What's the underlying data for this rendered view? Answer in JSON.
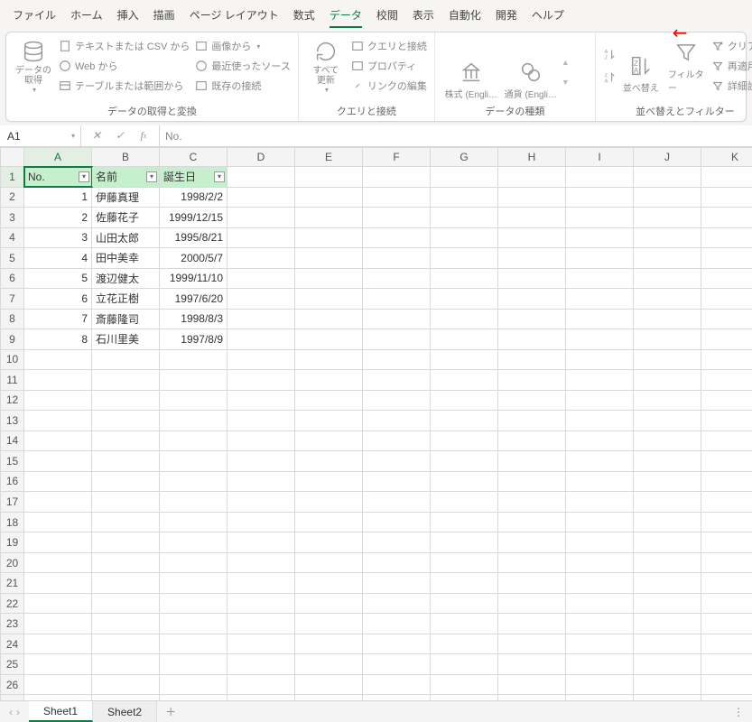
{
  "menus": [
    "ファイル",
    "ホーム",
    "挿入",
    "描画",
    "ページ レイアウト",
    "数式",
    "データ",
    "校閲",
    "表示",
    "自動化",
    "開発",
    "ヘルプ"
  ],
  "active_menu": "データ",
  "ribbon": {
    "group1": {
      "label": "データの取得と変換",
      "big": "データの\n取得",
      "items": [
        "テキストまたは CSV から",
        "Web から",
        "テーブルまたは範囲から",
        "画像から",
        "最近使ったソース",
        "既存の接続"
      ]
    },
    "group2": {
      "label": "クエリと接続",
      "big": "すべて\n更新",
      "items": [
        "クエリと接続",
        "プロパティ",
        "リンクの編集"
      ]
    },
    "group3": {
      "label": "データの種類",
      "items": [
        "株式 (Engli…",
        "通貨 (Engli…"
      ]
    },
    "group4": {
      "label": "並べ替えとフィルター",
      "sort": "並べ替え",
      "filter": "フィルター",
      "clear": "クリア",
      "reapply": "再適用",
      "advanced": "詳細設定"
    }
  },
  "cell_ref": "A1",
  "formula_value": "No.",
  "columns": [
    "A",
    "B",
    "C",
    "D",
    "E",
    "F",
    "G",
    "H",
    "I",
    "J",
    "K"
  ],
  "headers": {
    "A": "No.",
    "B": "名前",
    "C": "誕生日"
  },
  "rows": [
    {
      "n": 1,
      "name": "伊藤真理",
      "date": "1998/2/2"
    },
    {
      "n": 2,
      "name": "佐藤花子",
      "date": "1999/12/15"
    },
    {
      "n": 3,
      "name": "山田太郎",
      "date": "1995/8/21"
    },
    {
      "n": 4,
      "name": "田中美幸",
      "date": "2000/5/7"
    },
    {
      "n": 5,
      "name": "渡辺健太",
      "date": "1999/11/10"
    },
    {
      "n": 6,
      "name": "立花正樹",
      "date": "1997/6/20"
    },
    {
      "n": 7,
      "name": "斎藤隆司",
      "date": "1998/8/3"
    },
    {
      "n": 8,
      "name": "石川里美",
      "date": "1997/8/9"
    }
  ],
  "total_rows": 27,
  "tabs": [
    "Sheet1",
    "Sheet2"
  ],
  "active_tab": "Sheet1"
}
